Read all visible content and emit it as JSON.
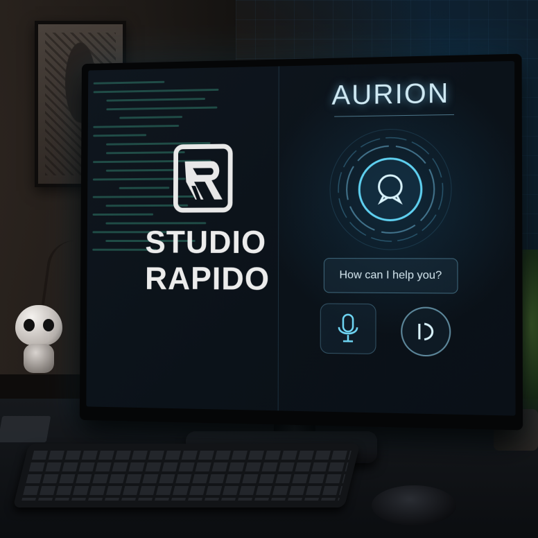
{
  "monitor": {
    "brand": {
      "line1": "STUDIO",
      "line2": "RAPIDO"
    },
    "assistant": {
      "title": "AURION",
      "prompt": "How can I help you?"
    }
  },
  "colors": {
    "accent": "#5fd0f0",
    "brand_text": "#ececec",
    "screen_bg": "#0b1219"
  },
  "icons": {
    "logo": "logo-r-icon",
    "assistant": "assistant-chat-icon",
    "mic": "microphone-icon",
    "play": "play-icon"
  }
}
